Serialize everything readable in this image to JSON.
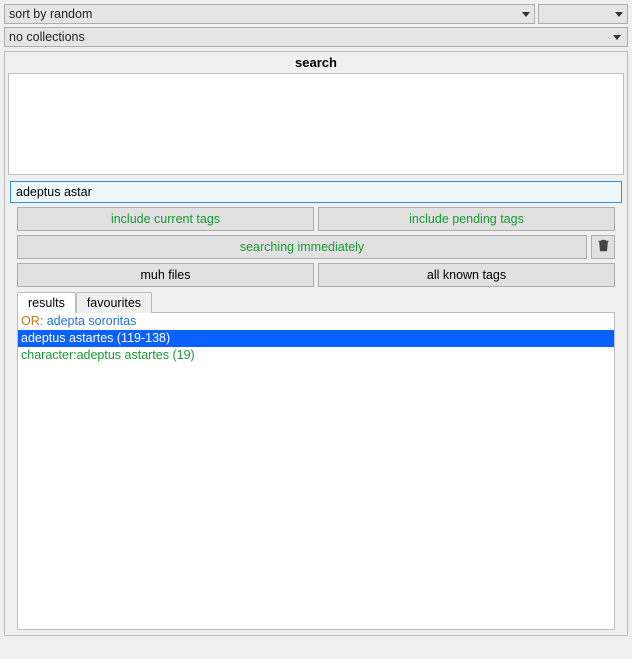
{
  "sort_dropdown": {
    "label": "sort by random"
  },
  "secondary_dropdown": {
    "label": ""
  },
  "collections": {
    "label": "no collections"
  },
  "search": {
    "header": "search",
    "input_value": "adeptus astar",
    "buttons": {
      "include_current": "include current tags",
      "include_pending": "include pending tags",
      "searching": "searching immediately",
      "muh_files": "muh files",
      "all_known": "all known tags"
    },
    "tabs": {
      "results": "results",
      "favourites": "favourites"
    },
    "results": {
      "or_label": "OR: ",
      "or_value": "adepta sororitas",
      "row2": "adeptus astartes (119-138)",
      "row3": "character:adeptus astartes (19)"
    }
  }
}
